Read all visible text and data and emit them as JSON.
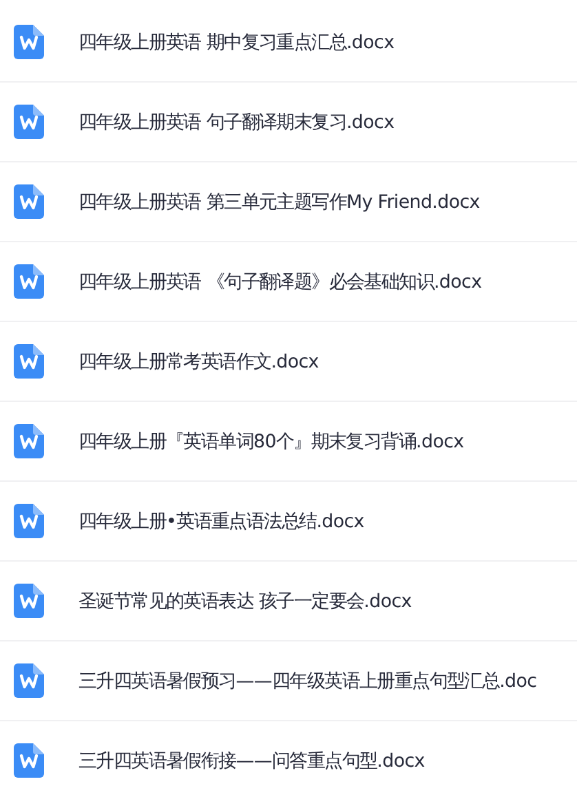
{
  "files": [
    {
      "name": "四年级上册英语 期中复习重点汇总.docx"
    },
    {
      "name": "四年级上册英语 句子翻译期末复习.docx"
    },
    {
      "name": "四年级上册英语 第三单元主题写作My Friend.docx"
    },
    {
      "name": "四年级上册英语 《句子翻译题》必会基础知识.docx"
    },
    {
      "name": "四年级上册常考英语作文.docx"
    },
    {
      "name": "四年级上册『英语单词80个』期末复习背诵.docx"
    },
    {
      "name": "四年级上册•英语重点语法总结.docx"
    },
    {
      "name": "圣诞节常见的英语表达 孩子一定要会.docx"
    },
    {
      "name": "三升四英语暑假预习——四年级英语上册重点句型汇总.doc"
    },
    {
      "name": "三升四英语暑假衔接——问答重点句型.docx"
    }
  ]
}
